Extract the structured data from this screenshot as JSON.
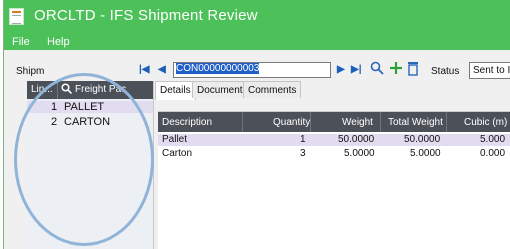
{
  "window": {
    "title": "ORCLTD - IFS Shipment Review"
  },
  "menu": [
    "File",
    "Help"
  ],
  "toolbar": {
    "shipment_label": "Shipm",
    "shipment_code": "CON00000000003",
    "status_label": "Status",
    "status_value": "Sent to IF"
  },
  "left_panel": {
    "header_line": "Lin...",
    "header_freight": "Freight Pac",
    "rows": [
      {
        "num": "1",
        "text": "PALLET"
      },
      {
        "num": "2",
        "text": "CARTON"
      }
    ]
  },
  "tabs": [
    "Details",
    "Documents",
    "Comments"
  ],
  "grid": {
    "columns": [
      "Description",
      "Quantity",
      "Weight",
      "Total Weight",
      "Cubic (m)"
    ],
    "rows": [
      [
        "Pallet",
        "1",
        "50.0000",
        "50.0000",
        "5.000"
      ],
      [
        "Carton",
        "3",
        "5.0000",
        "5.0000",
        "0.000"
      ]
    ]
  },
  "colors": {
    "title_bar": "#4cc159",
    "grid_header": "#4c5058",
    "selected_row": "#e2dcf0",
    "highlight_circle": "#90b4d8"
  }
}
